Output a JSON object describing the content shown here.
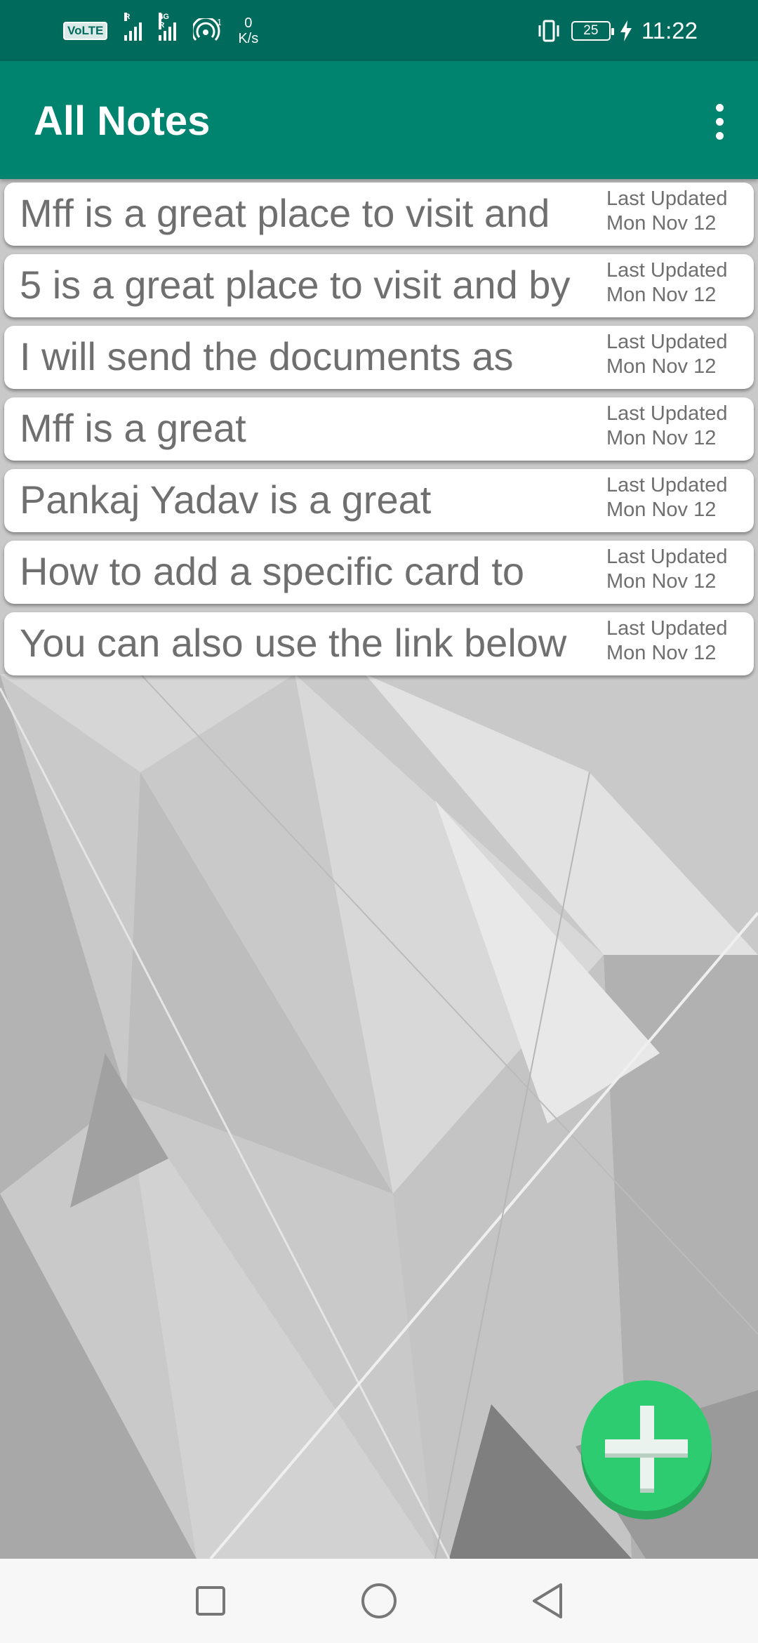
{
  "status_bar": {
    "volte": "VoLTE",
    "sim1_tag": "R",
    "sim2_tag": "4G R",
    "hotspot_badge": "1",
    "net_speed_value": "0",
    "net_speed_unit": "K/s",
    "battery_level": "25",
    "time": "11:22"
  },
  "app_bar": {
    "title": "All Notes",
    "overflow_icon": "more-vert-icon"
  },
  "notes": [
    {
      "title": "Mff is a great place to visit and",
      "updated_label": "Last Updated",
      "updated_date": "Mon Nov 12"
    },
    {
      "title": "5 is a great place to visit and by",
      "updated_label": "Last Updated",
      "updated_date": "Mon Nov 12"
    },
    {
      "title": "I will send the documents as",
      "updated_label": "Last Updated",
      "updated_date": "Mon Nov 12"
    },
    {
      "title": "Mff is a great",
      "updated_label": "Last Updated",
      "updated_date": "Mon Nov 12"
    },
    {
      "title": "Pankaj Yadav is a great",
      "updated_label": "Last Updated",
      "updated_date": "Mon Nov 12"
    },
    {
      "title": "How to add a specific card to",
      "updated_label": "Last Updated",
      "updated_date": "Mon Nov 12"
    },
    {
      "title": "You can also use the link below",
      "updated_label": "Last Updated",
      "updated_date": "Mon Nov 12"
    }
  ],
  "fab": {
    "icon": "plus-icon",
    "color": "#2ecc71"
  },
  "nav_bar": {
    "recents_icon": "square-recents-icon",
    "home_icon": "circle-home-icon",
    "back_icon": "triangle-back-icon"
  },
  "colors": {
    "status_bar": "#006a5c",
    "app_bar": "#00836f",
    "note_text": "#6f6f6f",
    "fab": "#2ecc71"
  }
}
